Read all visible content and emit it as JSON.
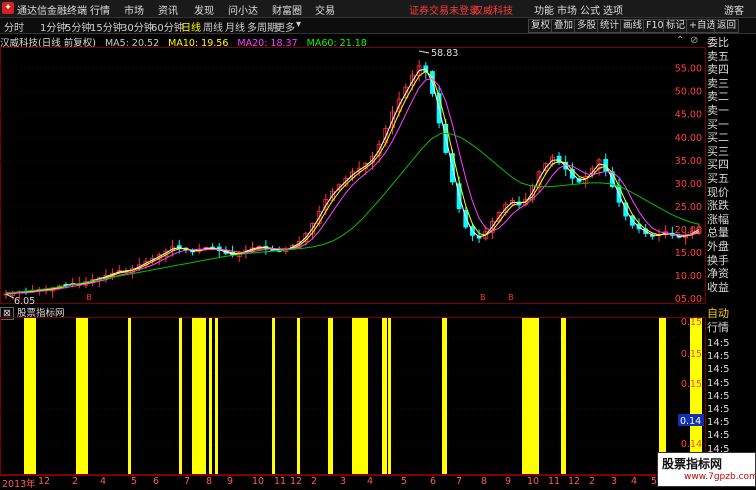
{
  "menubar": {
    "app_title": "通达信金融终端",
    "items": [
      "行情",
      "市场",
      "资讯",
      "发现",
      "问小达",
      "财富圈",
      "交易"
    ],
    "notice": "证券交易未登录",
    "stock_name": "汉威科技",
    "right_items": [
      "功能",
      "市场",
      "公式",
      "选项",
      "游客"
    ]
  },
  "periodbar": {
    "periods": [
      "分时",
      "1分钟",
      "5分钟",
      "15分钟",
      "30分钟",
      "60分钟",
      "日线",
      "周线",
      "月线",
      "多周期",
      "更多"
    ],
    "active": "日线",
    "buttons": [
      "复权",
      "叠加",
      "多股",
      "统计",
      "画线",
      "F10",
      "标记",
      "+自选",
      "返回"
    ]
  },
  "main_chart": {
    "title": "汉威科技(日线 前复权)",
    "ma": [
      {
        "label": "MA5: 20.52",
        "color": "#ffffff"
      },
      {
        "label": "MA10: 19.56",
        "color": "#ffff00"
      },
      {
        "label": "MA20: 18.37",
        "color": "#ff40ff"
      },
      {
        "label": "MA60: 21.18",
        "color": "#00ff00"
      }
    ],
    "max_label": "58.83",
    "min_label": "6.05",
    "price_ticks": [
      "55.00",
      "50.00",
      "45.00",
      "40.00",
      "35.00",
      "30.00",
      "25.00",
      "20.00",
      "15.00",
      "10.00",
      "05.00"
    ],
    "marks": [
      "B",
      "B",
      "B"
    ]
  },
  "chart_data": {
    "type": "candlestick",
    "ylim": [
      5,
      58.83
    ],
    "high": 58.83,
    "low": 6.05,
    "closes": [
      6.1,
      6.3,
      6.6,
      6.5,
      6.9,
      7.1,
      7.0,
      7.4,
      7.8,
      8.1,
      8.4,
      8.2,
      8.8,
      9.2,
      9.6,
      10.1,
      10.6,
      11.2,
      11.0,
      11.6,
      12.4,
      13.1,
      13.8,
      14.6,
      15.4,
      16.3,
      16.0,
      15.6,
      15.2,
      15.8,
      16.2,
      15.9,
      15.5,
      14.9,
      14.6,
      15.0,
      15.6,
      16.1,
      16.4,
      16.0,
      15.7,
      15.4,
      15.9,
      16.6,
      17.5,
      19.2,
      21.4,
      24.0,
      26.6,
      28.4,
      29.8,
      31.2,
      32.6,
      33.4,
      34.4,
      36.0,
      38.6,
      42.0,
      45.6,
      48.4,
      51.0,
      53.6,
      55.6,
      54.2,
      49.6,
      43.2,
      36.8,
      30.4,
      24.6,
      20.6,
      18.8,
      18.2,
      19.6,
      21.8,
      23.8,
      25.6,
      26.4,
      25.4,
      26.6,
      29.6,
      32.6,
      34.4,
      35.8,
      34.6,
      33.2,
      31.2,
      30.4,
      31.6,
      33.4,
      35.2,
      32.8,
      29.4,
      26.0,
      23.0,
      21.0,
      20.2,
      19.2,
      18.6,
      19.0,
      19.6,
      18.8,
      18.4,
      18.8,
      19.6,
      20.6
    ],
    "ma60": [
      6.4,
      6.5,
      6.7,
      6.9,
      7.2,
      7.5,
      7.8,
      8.2,
      8.6,
      9.0,
      9.4,
      9.8,
      10.2,
      10.6,
      11.0,
      11.4,
      11.8,
      12.2,
      12.6,
      13.0,
      13.4,
      13.8,
      14.2,
      14.5,
      14.8,
      15.0,
      15.2,
      15.4,
      15.6,
      15.8,
      16.0,
      16.3,
      16.8,
      17.6,
      18.8,
      20.4,
      22.4,
      24.8,
      27.2,
      29.8,
      32.4,
      35.0,
      37.6,
      39.8,
      41.0,
      40.8,
      40.0,
      38.6,
      37.0,
      35.2,
      33.4,
      31.6,
      30.2,
      29.6,
      29.4,
      29.4,
      29.6,
      29.8,
      30.0,
      30.2,
      30.2,
      30.0,
      29.4,
      28.4,
      27.2,
      26.0,
      24.8,
      23.6,
      22.6,
      21.8,
      21.2
    ]
  },
  "sub_chart": {
    "title": "股票指标网",
    "values": [
      "0.15",
      "0.15",
      "0.15",
      "0.14",
      "0.14"
    ],
    "current_value": "0.14"
  },
  "right_panel": {
    "labels": [
      "委比",
      "卖五",
      "卖四",
      "卖三",
      "卖二",
      "卖一",
      "买一",
      "买二",
      "买三",
      "买四",
      "买五",
      "现价",
      "涨跌",
      "涨幅",
      "总量",
      "外盘",
      "换手",
      "净资",
      "收益"
    ],
    "sub_labels": [
      "自动",
      "行情"
    ],
    "times": [
      "14:5",
      "14:5",
      "14:5",
      "14:5",
      "14:5",
      "14:5",
      "14:5",
      "14:5",
      "14:5",
      "14:5"
    ]
  },
  "xaxis": {
    "labels": [
      "2013年",
      "12",
      "2",
      "4",
      "5",
      "6",
      "7",
      "8",
      "9",
      "10",
      "11",
      "12",
      "2",
      "3",
      "4",
      "5",
      "6",
      "7",
      "8",
      "9",
      "10",
      "11",
      "12",
      "2",
      "3",
      "4",
      "5",
      "6",
      "7"
    ]
  },
  "watermark": {
    "text": "股票指标网",
    "url": "www.7gpzb.com"
  },
  "colors": {
    "up": "#ff3232",
    "down": "#00ffff",
    "volume_bar": "#ffff00",
    "grid": "#7a0000"
  }
}
